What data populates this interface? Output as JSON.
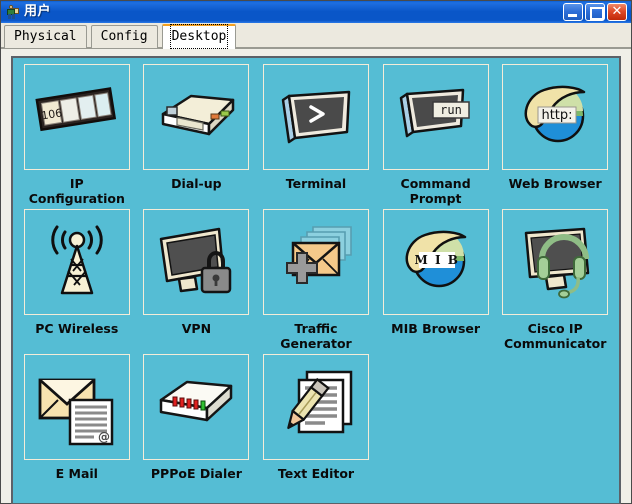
{
  "window": {
    "title": "用户",
    "icon": "user-person-icon",
    "buttons": {
      "minimize": "minimize-button",
      "maximize": "maximize-button",
      "close": "close-button"
    }
  },
  "tabs": [
    {
      "id": "physical",
      "label": "Physical",
      "active": false
    },
    {
      "id": "config",
      "label": "Config",
      "active": false
    },
    {
      "id": "desktop",
      "label": "Desktop",
      "active": true
    }
  ],
  "colors": {
    "desktop_background": "#55bdd4",
    "panel_border": "#5c6168",
    "window_background": "#f0efe8",
    "titlebar": "#0a56c8",
    "tab_active_accent": "#f3a020",
    "icon_cell_border": "#f4ecd8"
  },
  "desktop": {
    "icons": [
      {
        "id": "ip-configuration",
        "label": "IP\nConfiguration",
        "icon": "ip-configuration-icon",
        "badge": "106"
      },
      {
        "id": "dial-up",
        "label": "Dial-up",
        "icon": "dial-up-modem-icon"
      },
      {
        "id": "terminal",
        "label": "Terminal",
        "icon": "terminal-icon",
        "badge": ">"
      },
      {
        "id": "command-prompt",
        "label": "Command\nPrompt",
        "icon": "command-prompt-icon",
        "badge": "run"
      },
      {
        "id": "web-browser",
        "label": "Web Browser",
        "icon": "web-browser-globe-icon",
        "badge": "http:"
      },
      {
        "id": "pc-wireless",
        "label": "PC Wireless",
        "icon": "wireless-tower-icon"
      },
      {
        "id": "vpn",
        "label": "VPN",
        "icon": "vpn-monitor-lock-icon"
      },
      {
        "id": "traffic-generator",
        "label": "Traffic\nGenerator",
        "icon": "traffic-generator-envelopes-icon"
      },
      {
        "id": "mib-browser",
        "label": "MIB Browser",
        "icon": "mib-browser-globe-icon",
        "badge": "M I B"
      },
      {
        "id": "cisco-ip-communicator",
        "label": "Cisco IP\nCommunicator",
        "icon": "cisco-ip-communicator-icon"
      },
      {
        "id": "e-mail",
        "label": "E Mail",
        "icon": "email-envelope-icon",
        "badge": "@"
      },
      {
        "id": "pppoe-dialer",
        "label": "PPPoE Dialer",
        "icon": "pppoe-dialer-icon"
      },
      {
        "id": "text-editor",
        "label": "Text Editor",
        "icon": "text-editor-pencil-icon"
      }
    ]
  }
}
